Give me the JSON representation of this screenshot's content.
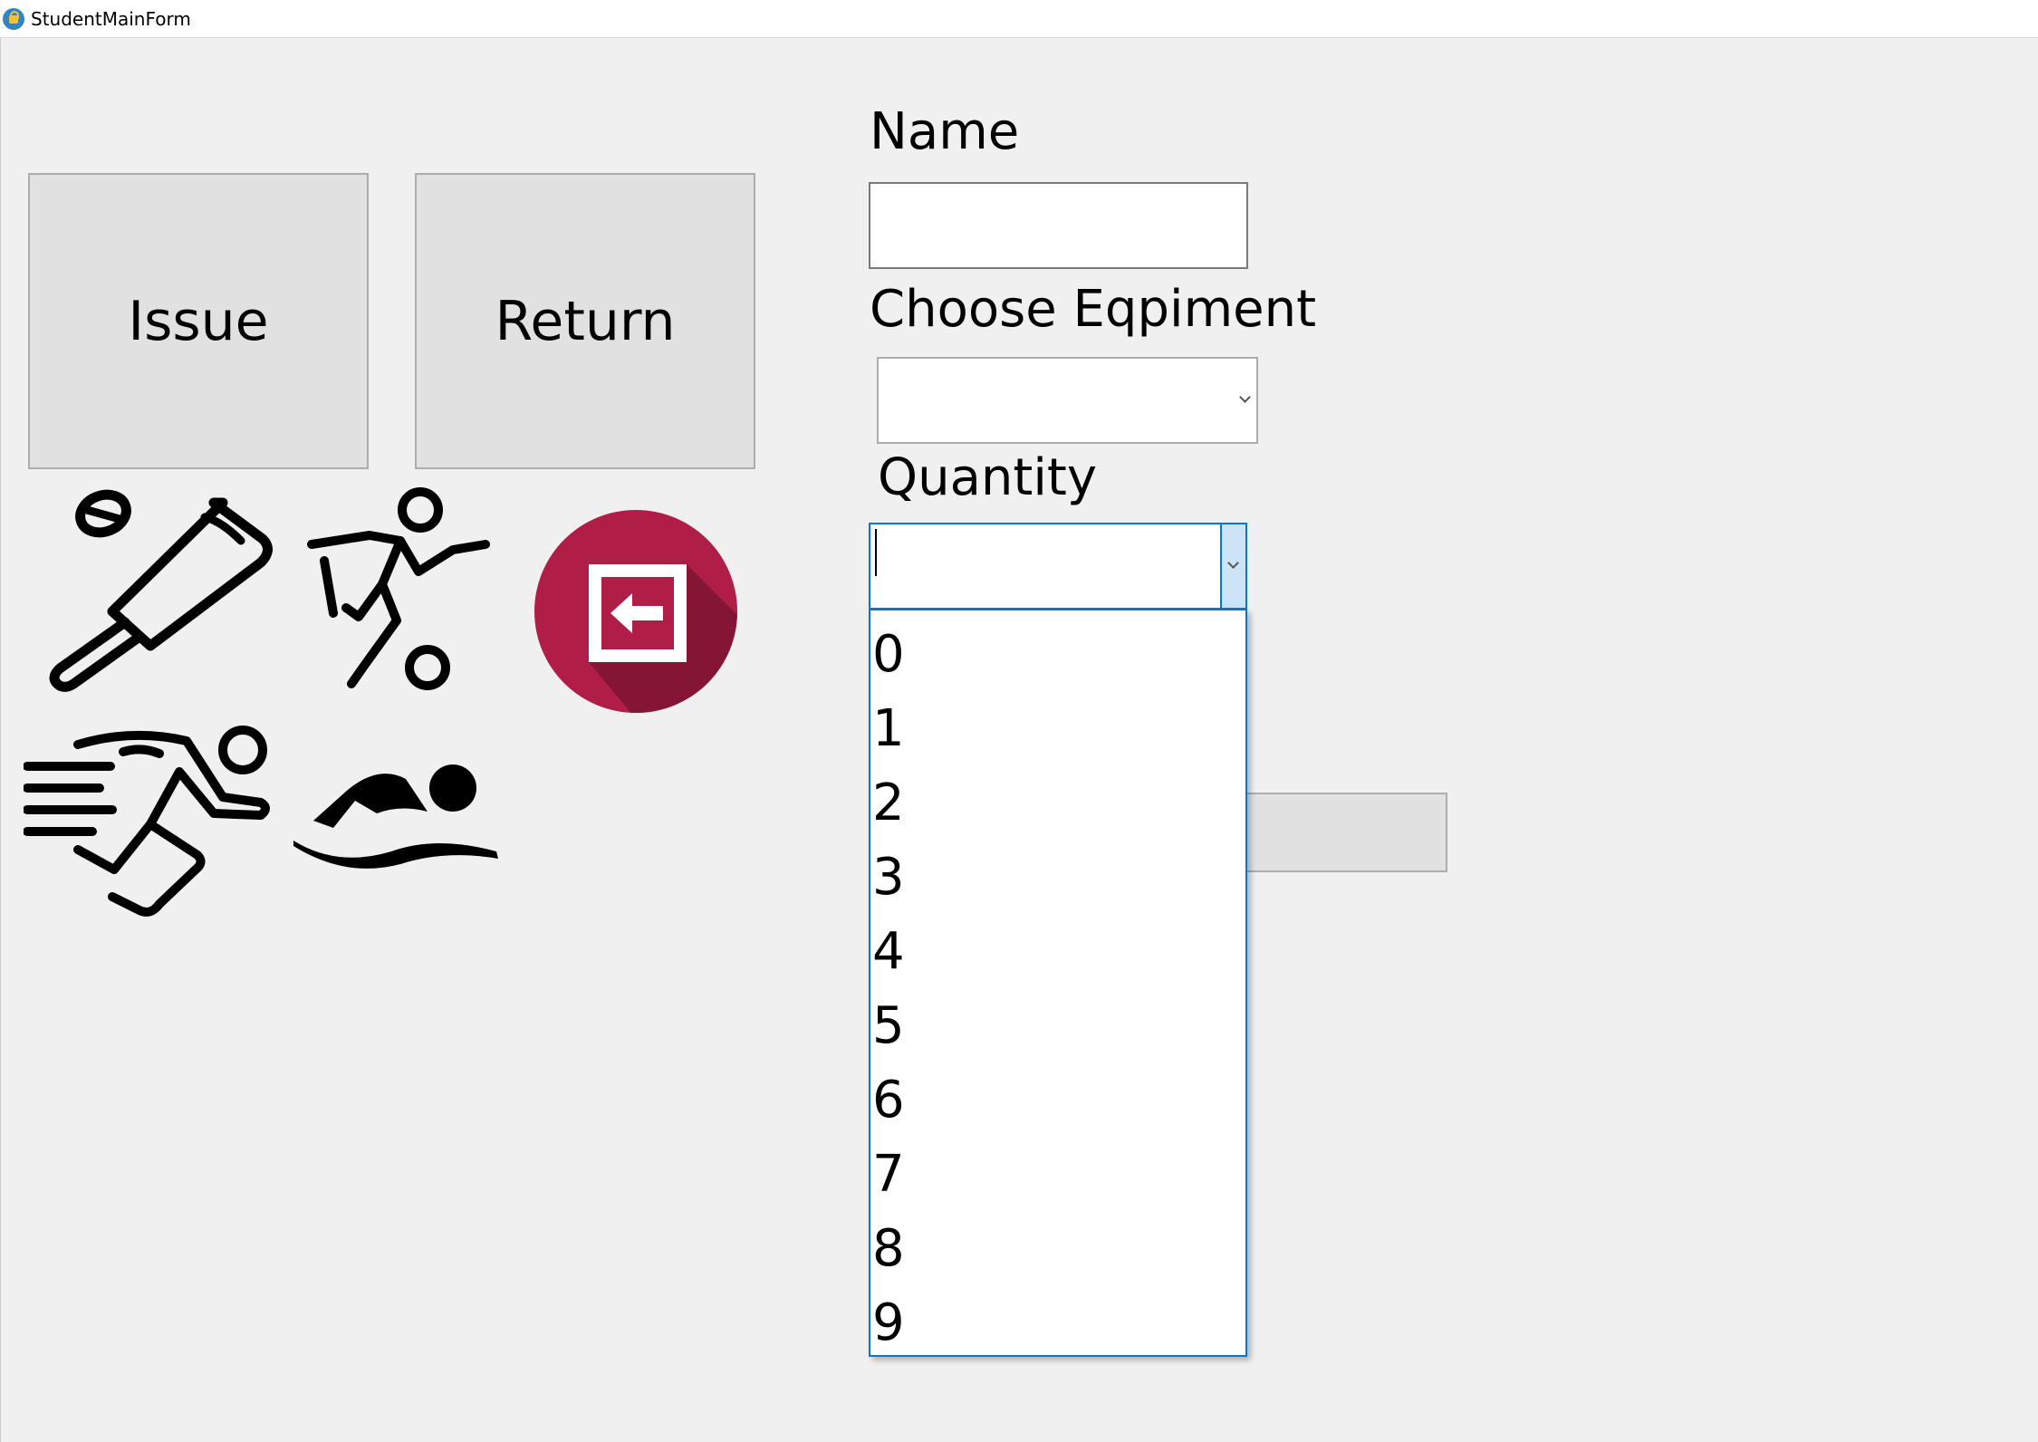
{
  "window": {
    "title": "StudentMainForm"
  },
  "buttons": {
    "issue_label": "Issue",
    "return_label": "Return"
  },
  "form": {
    "name_label": "Name",
    "name_value": "",
    "equipment_label": "Choose Eqpiment",
    "equipment_value": "",
    "quantity_label": "Quantity",
    "quantity_value": ""
  },
  "quantity_options": [
    "0",
    "1",
    "2",
    "3",
    "4",
    "5",
    "6",
    "7",
    "8",
    "9"
  ],
  "icons": [
    "cricket-icon",
    "football-icon",
    "logout-icon",
    "running-icon",
    "swimming-icon"
  ],
  "colors": {
    "logout_circle": "#b01e47",
    "logout_shadow": "#851535",
    "focus_blue": "#0078d7"
  }
}
